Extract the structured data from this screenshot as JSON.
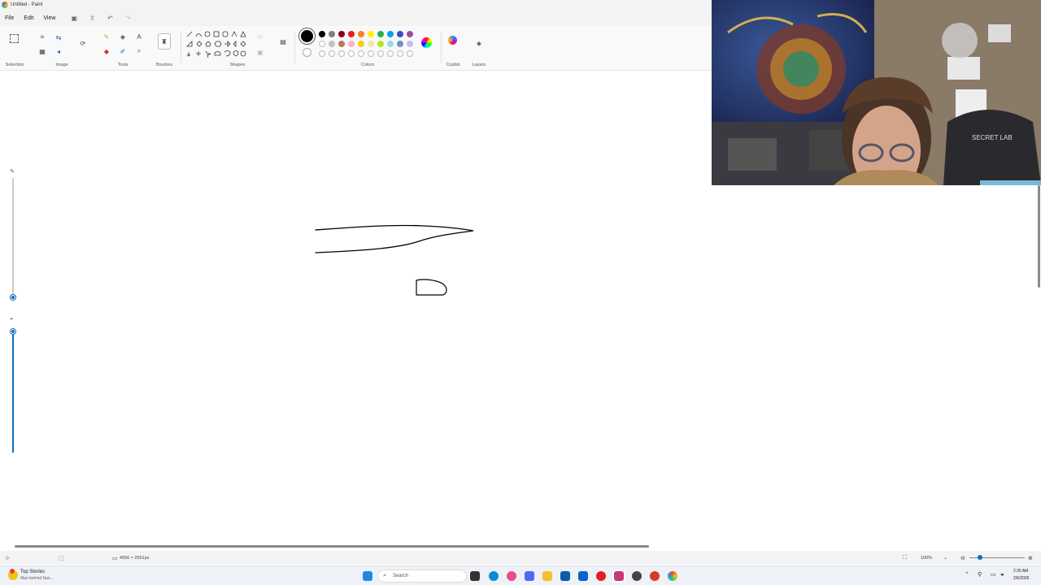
{
  "window": {
    "title": "Untitled - Paint"
  },
  "menu": {
    "file": "File",
    "edit": "Edit",
    "view": "View"
  },
  "ribbon": {
    "groups": {
      "selection": "Selection",
      "image": "Image",
      "tools": "Tools",
      "brushes": "Brushes",
      "shapes": "Shapes",
      "colors": "Colors",
      "copilot": "Copilot",
      "layers": "Layers"
    },
    "colors_row1": [
      "#000000",
      "#7f7f7f",
      "#880015",
      "#ed1c24",
      "#ff7f27",
      "#fff200",
      "#22b14c",
      "#00a2e8",
      "#3f48cc",
      "#a349a4"
    ],
    "colors_row2": [
      "#ffffff",
      "#c3c3c3",
      "#b97a57",
      "#ffaec9",
      "#ffc90e",
      "#efe4b0",
      "#b5e61d",
      "#99d9ea",
      "#7092be",
      "#c8bfe7"
    ],
    "active_color": "#000000"
  },
  "status": {
    "canvas_size": "4056 × 2561px",
    "zoom": "100%"
  },
  "taskbar": {
    "news_title": "Top Stories",
    "news_sub": "Man behind Nan...",
    "search_placeholder": "Search",
    "time": "2:35 AM",
    "date": "2/6/2026"
  }
}
